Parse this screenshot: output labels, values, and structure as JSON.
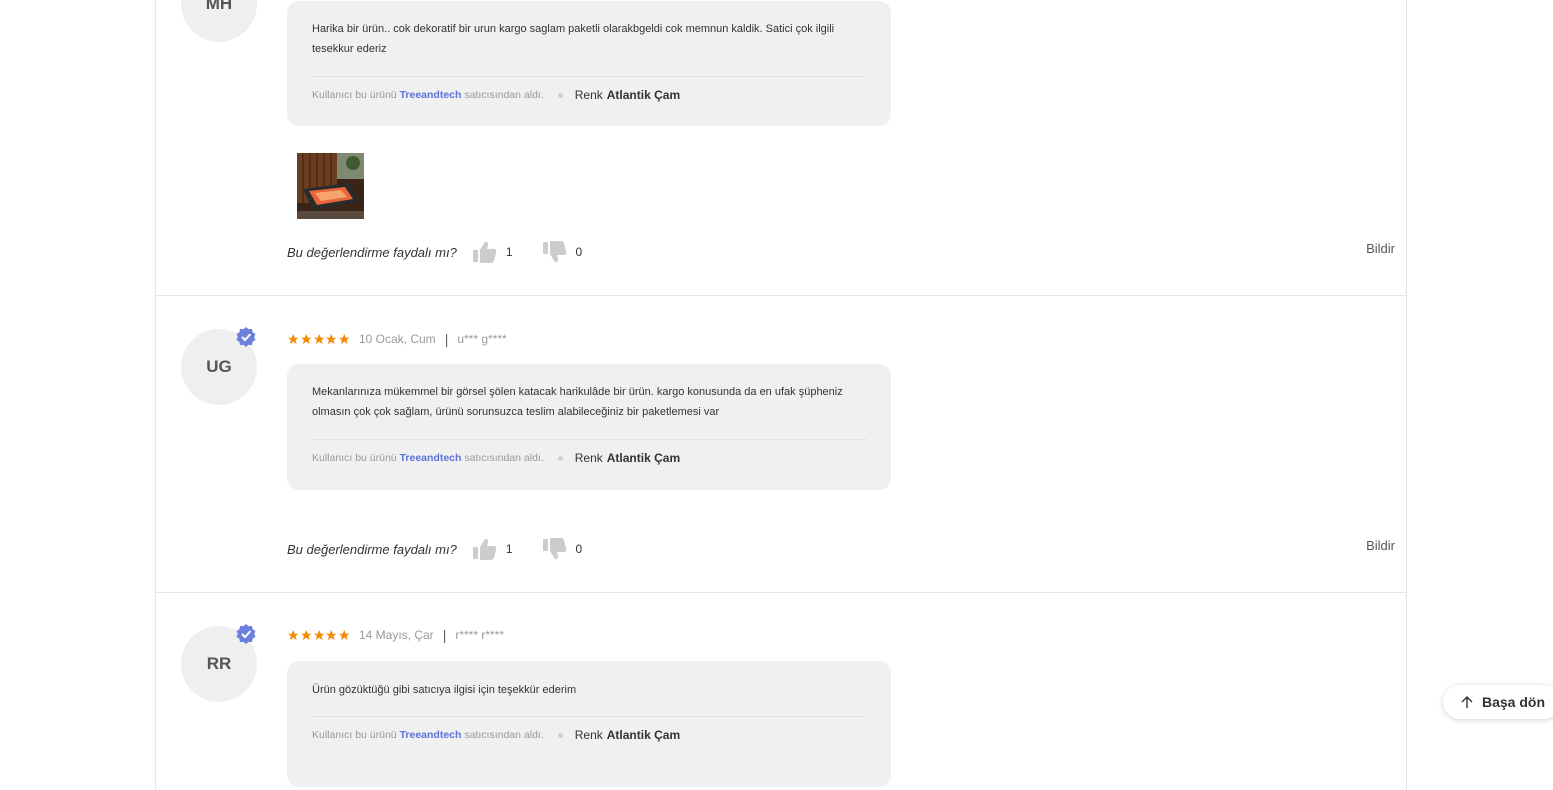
{
  "reviews": [
    {
      "initials": "MH",
      "text": "Harika bir ürün.. cok dekoratif bir urun kargo saglam paketli olarakbgeldi cok memnun kaldik. Satici çok ilgili tesekkur ederiz",
      "seller_prefix": "Kullanıcı bu ürünü",
      "seller_name": "Treeandtech",
      "seller_suffix": "satıcısından aldı.",
      "color_label": "Renk",
      "color_value": "Atlantik Çam",
      "helpful_q": "Bu değerlendirme faydalı mı?",
      "likes": "1",
      "dislikes": "0",
      "report": "Bildir"
    },
    {
      "initials": "UG",
      "rating": 5,
      "date": "10 Ocak, Cum",
      "user": "u*** g****",
      "text": "Mekanlarınıza mükemmel bir görsel şölen katacak harikulâde bir ürün. kargo konusunda da en ufak şüpheniz olmasın çok çok sağlam, ürünü sorunsuzca teslim alabileceğiniz bir paketlemesi var",
      "seller_prefix": "Kullanıcı bu ürünü",
      "seller_name": "Treeandtech",
      "seller_suffix": "satıcısından aldı.",
      "color_label": "Renk",
      "color_value": "Atlantik Çam",
      "helpful_q": "Bu değerlendirme faydalı mı?",
      "likes": "1",
      "dislikes": "0",
      "report": "Bildir"
    },
    {
      "initials": "RR",
      "rating": 5,
      "date": "14 Mayıs, Çar",
      "user": "r**** r****",
      "text": "Ürün gözüktüğü gibi satıcıya ilgisi için teşekkür ederim",
      "seller_prefix": "Kullanıcı bu ürünü",
      "seller_name": "Treeandtech",
      "seller_suffix": "satıcısından aldı.",
      "color_label": "Renk",
      "color_value": "Atlantik Çam"
    }
  ],
  "back_to_top": "Başa dön",
  "colors": {
    "star": "#f28b00",
    "badge": "#6b7fdc",
    "seller_link": "#5b74d6",
    "vote_icon": "#cccccc"
  }
}
